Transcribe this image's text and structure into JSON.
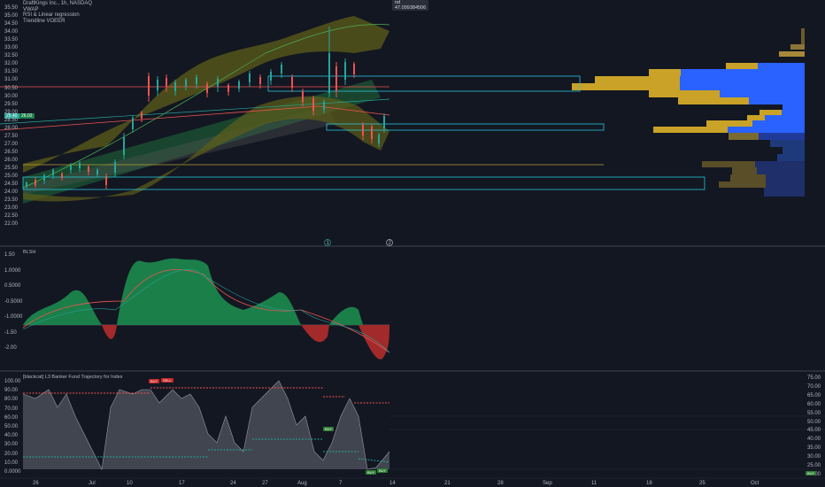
{
  "header": {
    "title": "DraftKings Inc., 1h, NASDAQ",
    "indicators": [
      "VWAP",
      "RSI & Linear regression",
      "Trendline VOEER"
    ]
  },
  "price_tag": {
    "line1": "nd",
    "line2": "47.099384506"
  },
  "current_price": {
    "a": "25.40",
    "b": "26.02"
  },
  "main_axis": [
    "35.50",
    "35.00",
    "34.50",
    "34.00",
    "33.50",
    "33.00",
    "32.50",
    "32.00",
    "31.50",
    "31.00",
    "30.50",
    "30.00",
    "29.50",
    "29.00",
    "28.50",
    "28.00",
    "27.50",
    "27.00",
    "26.50",
    "26.00",
    "25.50",
    "25.00",
    "24.50",
    "24.00",
    "23.50",
    "23.00",
    "22.50",
    "22.00"
  ],
  "osc_axis": [
    "1.50",
    "1.0000",
    "0.5000",
    "-0.5000",
    "-1.0000",
    "-1.50",
    "-2.00"
  ],
  "osc_title": "BLSH",
  "fund_title": "[blackcat] L3 Banker Fund Trajectory for Index",
  "fund_axis_left": [
    "100.00",
    "90.00",
    "80.00",
    "70.00",
    "60.00",
    "50.00",
    "40.00",
    "30.00",
    "20.00",
    "10.00",
    "0.0000"
  ],
  "fund_axis_right": [
    "75.00",
    "70.00",
    "65.00",
    "60.00",
    "55.00",
    "50.00",
    "45.00",
    "40.00",
    "35.00",
    "30.00",
    "25.00",
    "20.00"
  ],
  "signals": {
    "buy1": "BUY",
    "sell1": "SELL",
    "buy2": "BUY",
    "buy3": "BUY",
    "buy4": "BUY",
    "buy5": "BUY"
  },
  "time_axis": [
    "26",
    "Jul",
    "10",
    "17",
    "24",
    "27",
    "Aug",
    "7",
    "14",
    "21",
    "28",
    "Sep",
    "11",
    "18",
    "25",
    "Oct"
  ],
  "markers": {
    "m1": "1",
    "m2": "2"
  },
  "colors": {
    "up": "#26a69a",
    "down": "#ef5350",
    "accent_green": "#00c853",
    "osc_red": "#c62828",
    "cyan": "#26c6da",
    "olive": "#6b6b1e",
    "vp_blue": "#2962ff",
    "vp_gold": "#c9a227"
  }
}
